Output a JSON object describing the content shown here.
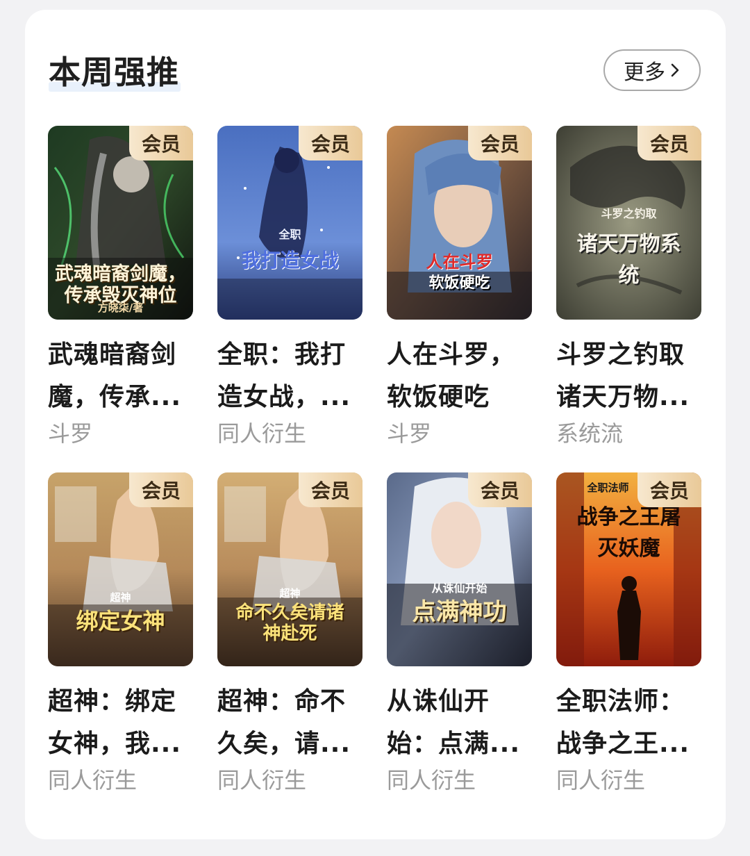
{
  "section": {
    "title": "本周强推",
    "more_label": "更多"
  },
  "badge_label": "会员",
  "books": [
    {
      "title_line1": "武魂暗裔剑",
      "title_line2": "魔，传承...",
      "genre": "斗罗",
      "cover_text": "武魂暗裔剑魔，传承毁灭神位",
      "cover_author": "方晓柒/著"
    },
    {
      "title_line1": "全职：我打",
      "title_line2": "造女战，...",
      "genre": "同人衍生",
      "cover_text": "我打造女战",
      "cover_author": "全职"
    },
    {
      "title_line1": "人在斗罗，",
      "title_line2": "软饭硬吃",
      "genre": "斗罗",
      "cover_text": "人在斗罗",
      "cover_author": "软饭硬吃"
    },
    {
      "title_line1": "斗罗之钓取",
      "title_line2": "诸天万物...",
      "genre": "系统流",
      "cover_text": "诸天万物系统",
      "cover_author": "斗罗之钓取"
    },
    {
      "title_line1": "超神：绑定",
      "title_line2": "女神，我...",
      "genre": "同人衍生",
      "cover_text": "绑定女神",
      "cover_author": "超神"
    },
    {
      "title_line1": "超神：命不",
      "title_line2": "久矣，请...",
      "genre": "同人衍生",
      "cover_text": "命不久矣请诸神赴死",
      "cover_author": "超神"
    },
    {
      "title_line1": "从诛仙开",
      "title_line2": "始：点满...",
      "genre": "同人衍生",
      "cover_text": "点满神功",
      "cover_author": "从诛仙开始"
    },
    {
      "title_line1": "全职法师：",
      "title_line2": "战争之王...",
      "genre": "同人衍生",
      "cover_text": "战争之王屠灭妖魔",
      "cover_author": "全职法师"
    }
  ]
}
